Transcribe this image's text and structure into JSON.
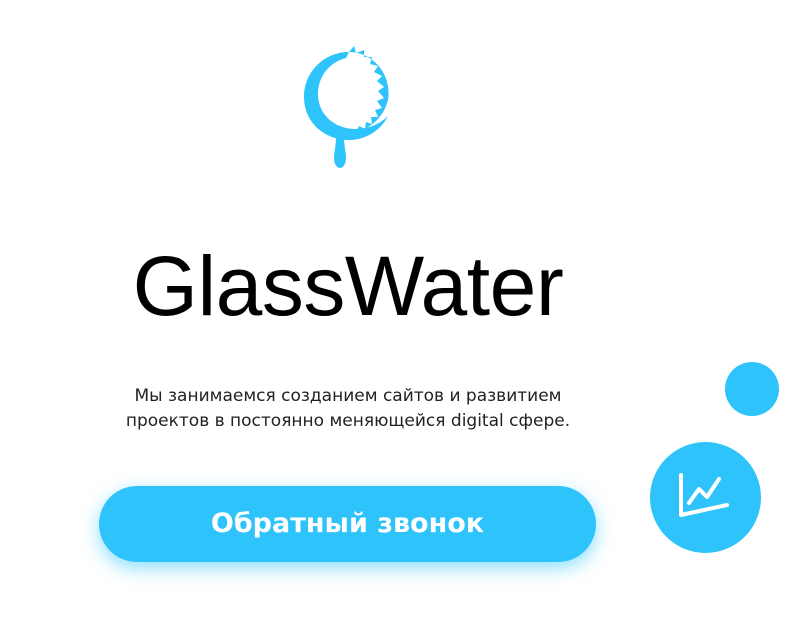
{
  "brand": {
    "name": "GlassWater",
    "logo_icon": "water-drop-ring-icon"
  },
  "tagline": {
    "line1": "Мы занимаемся созданием сайтов и развитием",
    "line2": "проектов в постоянно меняющейся digital сфере."
  },
  "cta": {
    "label": "Обратный звонок"
  },
  "widgets": {
    "stats_icon": "line-chart-icon",
    "dot_icon": "circle-dot"
  },
  "colors": {
    "accent": "#2ec4fb",
    "text": "#000000",
    "background": "#ffffff"
  }
}
